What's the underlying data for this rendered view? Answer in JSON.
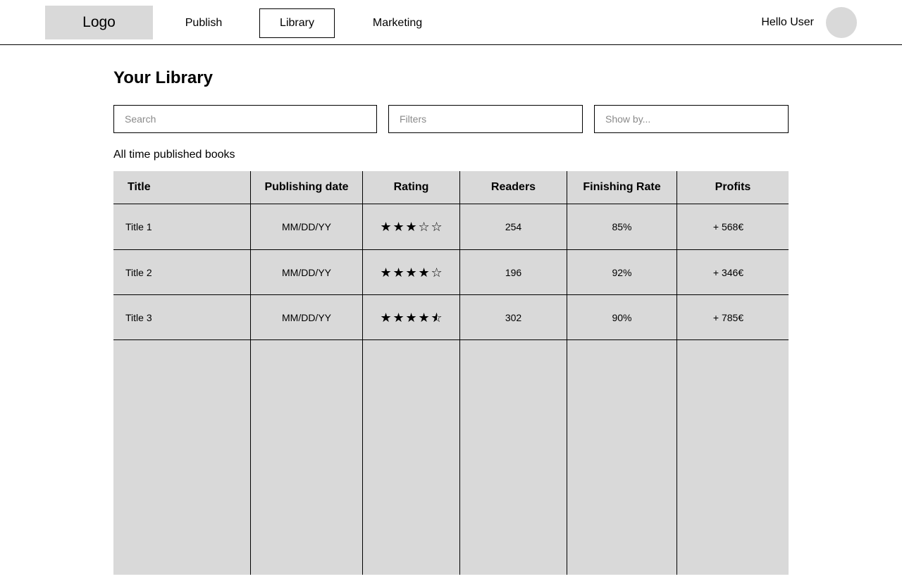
{
  "header": {
    "logo": "Logo",
    "nav": {
      "publish": "Publish",
      "library": "Library",
      "marketing": "Marketing"
    },
    "greeting": "Hello User"
  },
  "main": {
    "title": "Your Library",
    "search": {
      "placeholder": "Search",
      "value": ""
    },
    "filters": {
      "placeholder": "Filters",
      "value": ""
    },
    "show_by": {
      "placeholder": "Show by...",
      "value": ""
    },
    "section_label": "All time published books"
  },
  "table": {
    "columns": {
      "title": "Title",
      "publishing_date": "Publishing date",
      "rating": "Rating",
      "readers": "Readers",
      "finishing_rate": "Finishing Rate",
      "profits": "Profits"
    },
    "rows": [
      {
        "title": "Title 1",
        "publishing_date": "MM/DD/YY",
        "rating": 3,
        "readers": "254",
        "finishing_rate": "85%",
        "profits": "+ 568€"
      },
      {
        "title": "Title 2",
        "publishing_date": "MM/DD/YY",
        "rating": 4,
        "readers": "196",
        "finishing_rate": "92%",
        "profits": "+ 346€"
      },
      {
        "title": "Title 3",
        "publishing_date": "MM/DD/YY",
        "rating": 4.5,
        "readers": "302",
        "finishing_rate": "90%",
        "profits": "+ 785€"
      }
    ],
    "rating_max": 5,
    "icons": {
      "star_full": "star-filled-icon",
      "star_empty": "star-outline-icon",
      "star_half": "star-half-icon"
    }
  }
}
